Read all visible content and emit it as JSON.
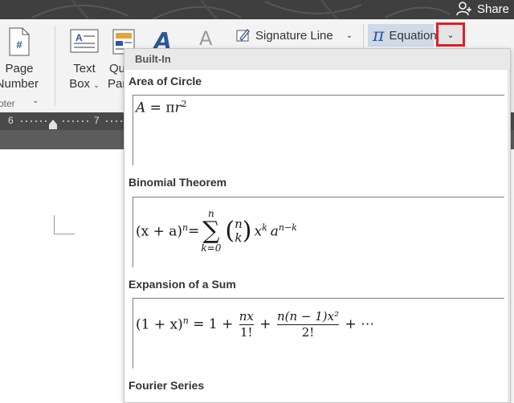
{
  "titlebar": {
    "share_label": "Share"
  },
  "ribbon": {
    "page_number": {
      "line1": "Page",
      "line2": "Number"
    },
    "footer_group": "oter",
    "text_box": {
      "line1": "Text",
      "line2": "Box"
    },
    "quick_parts": {
      "line1": "Qu",
      "line2": "Part"
    },
    "signature_line_label": "Signature Line",
    "equation_label": "Equation"
  },
  "ruler": {
    "mark_6": "6",
    "mark_7": "7"
  },
  "gallery": {
    "header": "Built-In",
    "sections": [
      {
        "title": "Area of Circle"
      },
      {
        "title": "Binomial Theorem"
      },
      {
        "title": "Expansion of a Sum"
      },
      {
        "title": "Fourier Series"
      }
    ],
    "eq1": {
      "lhs": "A",
      "op": " = π",
      "r": "r",
      "exp": "2"
    },
    "eq2": {
      "lhs": "(x + a)",
      "lhs_exp": "n",
      "op": " = ",
      "sum_top": "n",
      "sum_bottom": "k=0",
      "binom_top": "n",
      "binom_bottom": "k",
      "x": "x",
      "x_exp": "k",
      "a": "a",
      "a_exp": "n−k"
    },
    "eq3": {
      "lhs": "(1 + x)",
      "lhs_exp": "n",
      "op": " = 1 + ",
      "f1_num": "nx",
      "f1_den": "1!",
      "plus": " + ",
      "f2_num": "n(n − 1)x²",
      "f2_den": "2!",
      "tail": " + ⋯"
    }
  },
  "colors": {
    "highlight": "#e01e26",
    "equation_pi": "#2b579a"
  }
}
